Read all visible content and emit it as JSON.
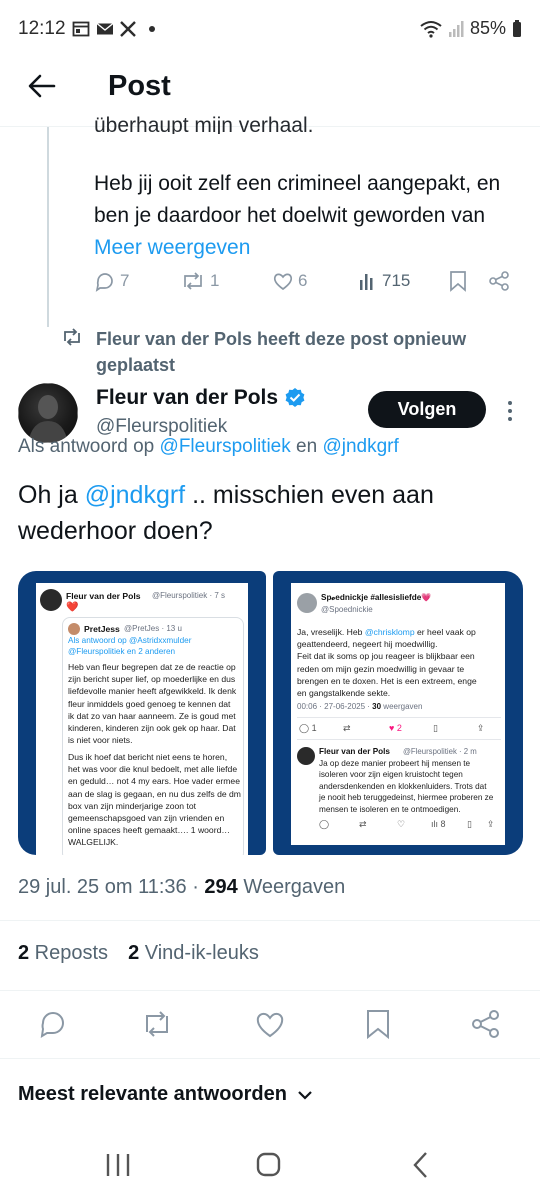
{
  "status_bar": {
    "time": "12:12",
    "battery": "85%"
  },
  "header": {
    "title": "Post"
  },
  "previous_post": {
    "cut_line": "überhaupt mijn verhaal.",
    "text_before_link": "Heb jij ooit zelf een crimineel aangepakt, en ben je daardoor het doelwit geworden van ",
    "more_link": "Meer weergeven",
    "replies": "7",
    "reposts": "1",
    "likes": "6",
    "views": "715"
  },
  "repost_label": "Fleur van der Pols heeft deze post opnieuw geplaatst",
  "author": {
    "name": "Fleur van der Pols",
    "handle": "@Fleurspolitiek",
    "follow_label": "Volgen"
  },
  "reply_to": {
    "prefix": "Als antwoord op ",
    "user1": "@Fleurspolitiek",
    "joiner": " en ",
    "user2": "@jndkgrf"
  },
  "post": {
    "prefix": "Oh ja ",
    "mention": "@jndkgrf",
    "rest": " .. misschien even aan wederhoor doen?"
  },
  "media_left": {
    "name": "Fleur van der Pols",
    "handle": "@Fleurspolitiek · 7 s",
    "heart": "❤️",
    "quoted_name": "PretJess",
    "quoted_handle": "@PretJes · 13 u",
    "quoted_reply": "Als antwoord op @Astridxxmulder",
    "quoted_reply2": "@Fleurspolitiek en 2 anderen",
    "para1": [
      "Heb van fleur begrepen dat ze de reactie op",
      "zijn bericht super lief, op moederlijke en dus",
      "liefdevolle manier heeft afgewikkeld. Ik denk",
      "fleur inmiddels goed genoeg te kennen dat",
      "ik dat zo van haar aanneem. Ze is goud met",
      "kinderen, kinderen zijn ook gek op haar. Dat",
      "is niet voor niets."
    ],
    "para2": [
      "Dus ik hoef dat bericht niet eens te horen,",
      "het was voor die knul bedoelt, met alle liefde",
      "en geduld… not 4 my ears. Hoe vader ermee",
      "aan de slag is gegaan, en nu dus zelfs de dm",
      "box van zijn minderjarige zoon tot",
      "gemeenschapsgoed van zijn vrienden en",
      "online spaces heeft gemaakt…. 1 woord…",
      "WALGELIJK."
    ]
  },
  "media_right": {
    "name": "Sp𝓸ednickje #allesisliefde💗",
    "handle": "@Spoednickie",
    "text_a": "Ja, vreselijk. Heb ",
    "text_a_link": "@chrisklomp",
    "text_a_rest": " er heel vaak op",
    "lines": [
      "geattendeerd, negeert hij moedwillig.",
      "Feit dat ik soms op jou reageer is blijkbaar een",
      "reden om mijn gezin moedwillig in gevaar te",
      "brengen en te doxen. Het is een extreem, enge",
      "en gangstalkende sekte."
    ],
    "date": "00:06 · 27-06-2025 · ",
    "views_count": "30",
    "views_label": " weergaven",
    "stat_reply": "1",
    "stat_like": "2",
    "reply_name": "Fleur van der Pols",
    "reply_handle": "@Fleurspolitiek · 2 m",
    "reply_lines": [
      "Ja op deze manier probeert hij mensen te",
      "isoleren voor zijn eigen kruistocht tegen",
      "andersdenkenden en klokkenluiders. Trots dat",
      "je nooit heb teruggedeinst, hiermee proberen ze",
      "mensen te isoleren en te ontmoedigen."
    ],
    "reply_views": "8"
  },
  "meta": {
    "datetime": "29 jul. 25 om 11:36 · ",
    "views": "294",
    "views_label": " Weergaven"
  },
  "stats": {
    "reposts": "2",
    "reposts_label": " Reposts",
    "likes": "2",
    "likes_label": " Vind-ik-leuks"
  },
  "replies_sort": "Meest relevante antwoorden",
  "colors": {
    "accent": "#1d9bf0",
    "text": "#0f1419",
    "secondary": "#536471",
    "media_bg": "#0b3d7a"
  }
}
